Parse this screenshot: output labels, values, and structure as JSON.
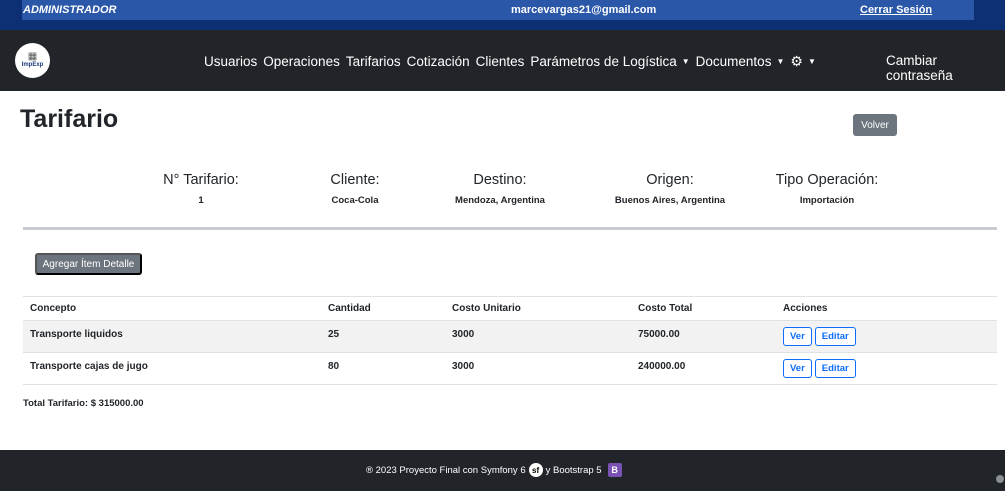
{
  "topbar": {
    "role": "ADMINISTRADOR",
    "email": "marcevargas21@gmail.com",
    "logout": "Cerrar Sesión"
  },
  "navbar": {
    "brand": "ImpExp",
    "items": [
      "Usuarios",
      "Operaciones",
      "Tarifarios",
      "Cotización",
      "Clientes",
      "Parámetros de Logística",
      "Documentos"
    ],
    "right_link": "Cambiar contraseña"
  },
  "page": {
    "title": "Tarifario",
    "back_button": "Volver",
    "add_button": "Agregar Ítem Detalle"
  },
  "info": {
    "labels": [
      "N° Tarifario:",
      "Cliente:",
      "Destino:",
      "Origen:",
      "Tipo Operación:"
    ],
    "values": [
      "1",
      "Coca-Cola",
      "Mendoza, Argentina",
      "Buenos Aires, Argentina",
      "Importación"
    ]
  },
  "table": {
    "headers": [
      "Concepto",
      "Cantidad",
      "Costo Unitario",
      "Costo Total",
      "Acciones"
    ],
    "rows": [
      {
        "concepto": "Transporte liquidos",
        "cantidad": "25",
        "costo_unitario": "3000",
        "costo_total": "75000.00"
      },
      {
        "concepto": "Transporte cajas de jugo",
        "cantidad": "80",
        "costo_unitario": "3000",
        "costo_total": "240000.00"
      }
    ],
    "view_label": "Ver",
    "edit_label": "Editar"
  },
  "total": "Total Tarifario: $ 315000.00",
  "footer": {
    "text_before": "® 2023 Proyecto Final con Symfony 6",
    "text_after": "y Bootstrap 5"
  },
  "icons": {
    "settings": "gear-icon",
    "dropdown": "caret-down-icon",
    "symfony": "symfony-logo-icon",
    "bootstrap": "bootstrap-logo-icon"
  },
  "colors": {
    "topbar": "#0d2f73",
    "navbar": "#212529",
    "secondary_button": "#6c757d",
    "outline_button": "#0d6efd"
  }
}
